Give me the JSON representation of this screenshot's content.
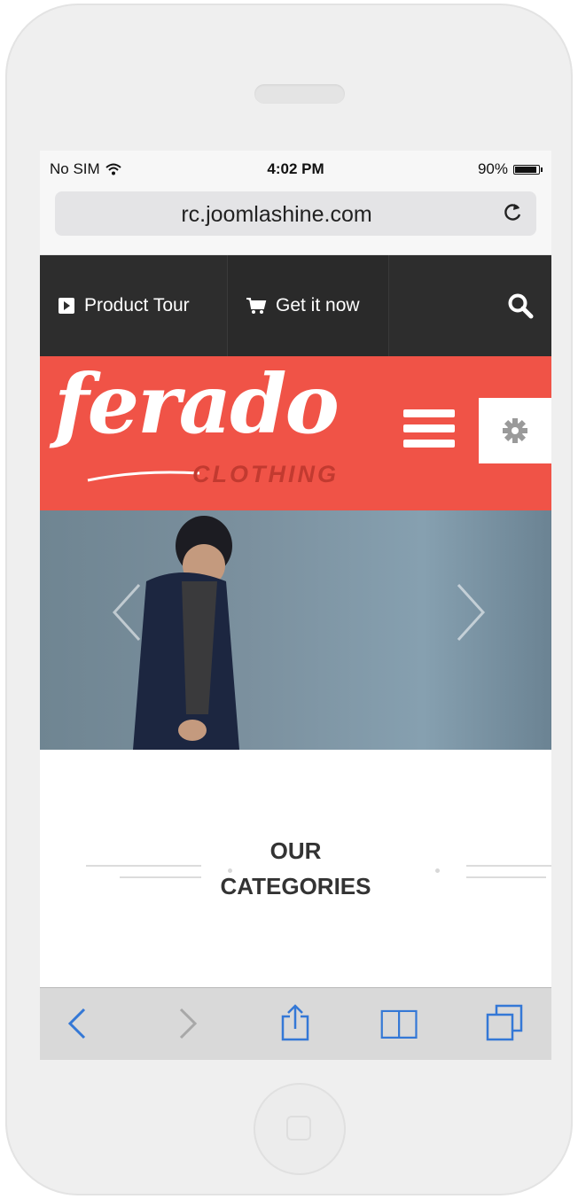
{
  "status_bar": {
    "carrier": "No SIM",
    "time": "4:02 PM",
    "battery": "90%",
    "battery_level": 0.9
  },
  "browser": {
    "url": "rc.joomlashine.com"
  },
  "top_nav": {
    "product_tour": "Product Tour",
    "get_it_now": "Get it now"
  },
  "brand": {
    "logo": "ferado",
    "logo_sub": "CLOTHING",
    "color": "#f05347"
  },
  "categories": {
    "title_line1": "OUR",
    "title_line2": "CATEGORIES"
  },
  "colors": {
    "nav_bg": "#2d2d2d",
    "accent_red": "#f05347",
    "ios_blue": "#3478d6"
  },
  "icons": {
    "wifi": "wifi-icon",
    "reload": "reload-icon",
    "play": "play-icon",
    "cart": "cart-icon",
    "search": "search-icon",
    "menu": "hamburger-icon",
    "gear": "gear-icon",
    "back": "back-icon",
    "forward": "forward-icon",
    "share": "share-icon",
    "bookmarks": "bookmarks-icon",
    "tabs": "tabs-icon"
  }
}
